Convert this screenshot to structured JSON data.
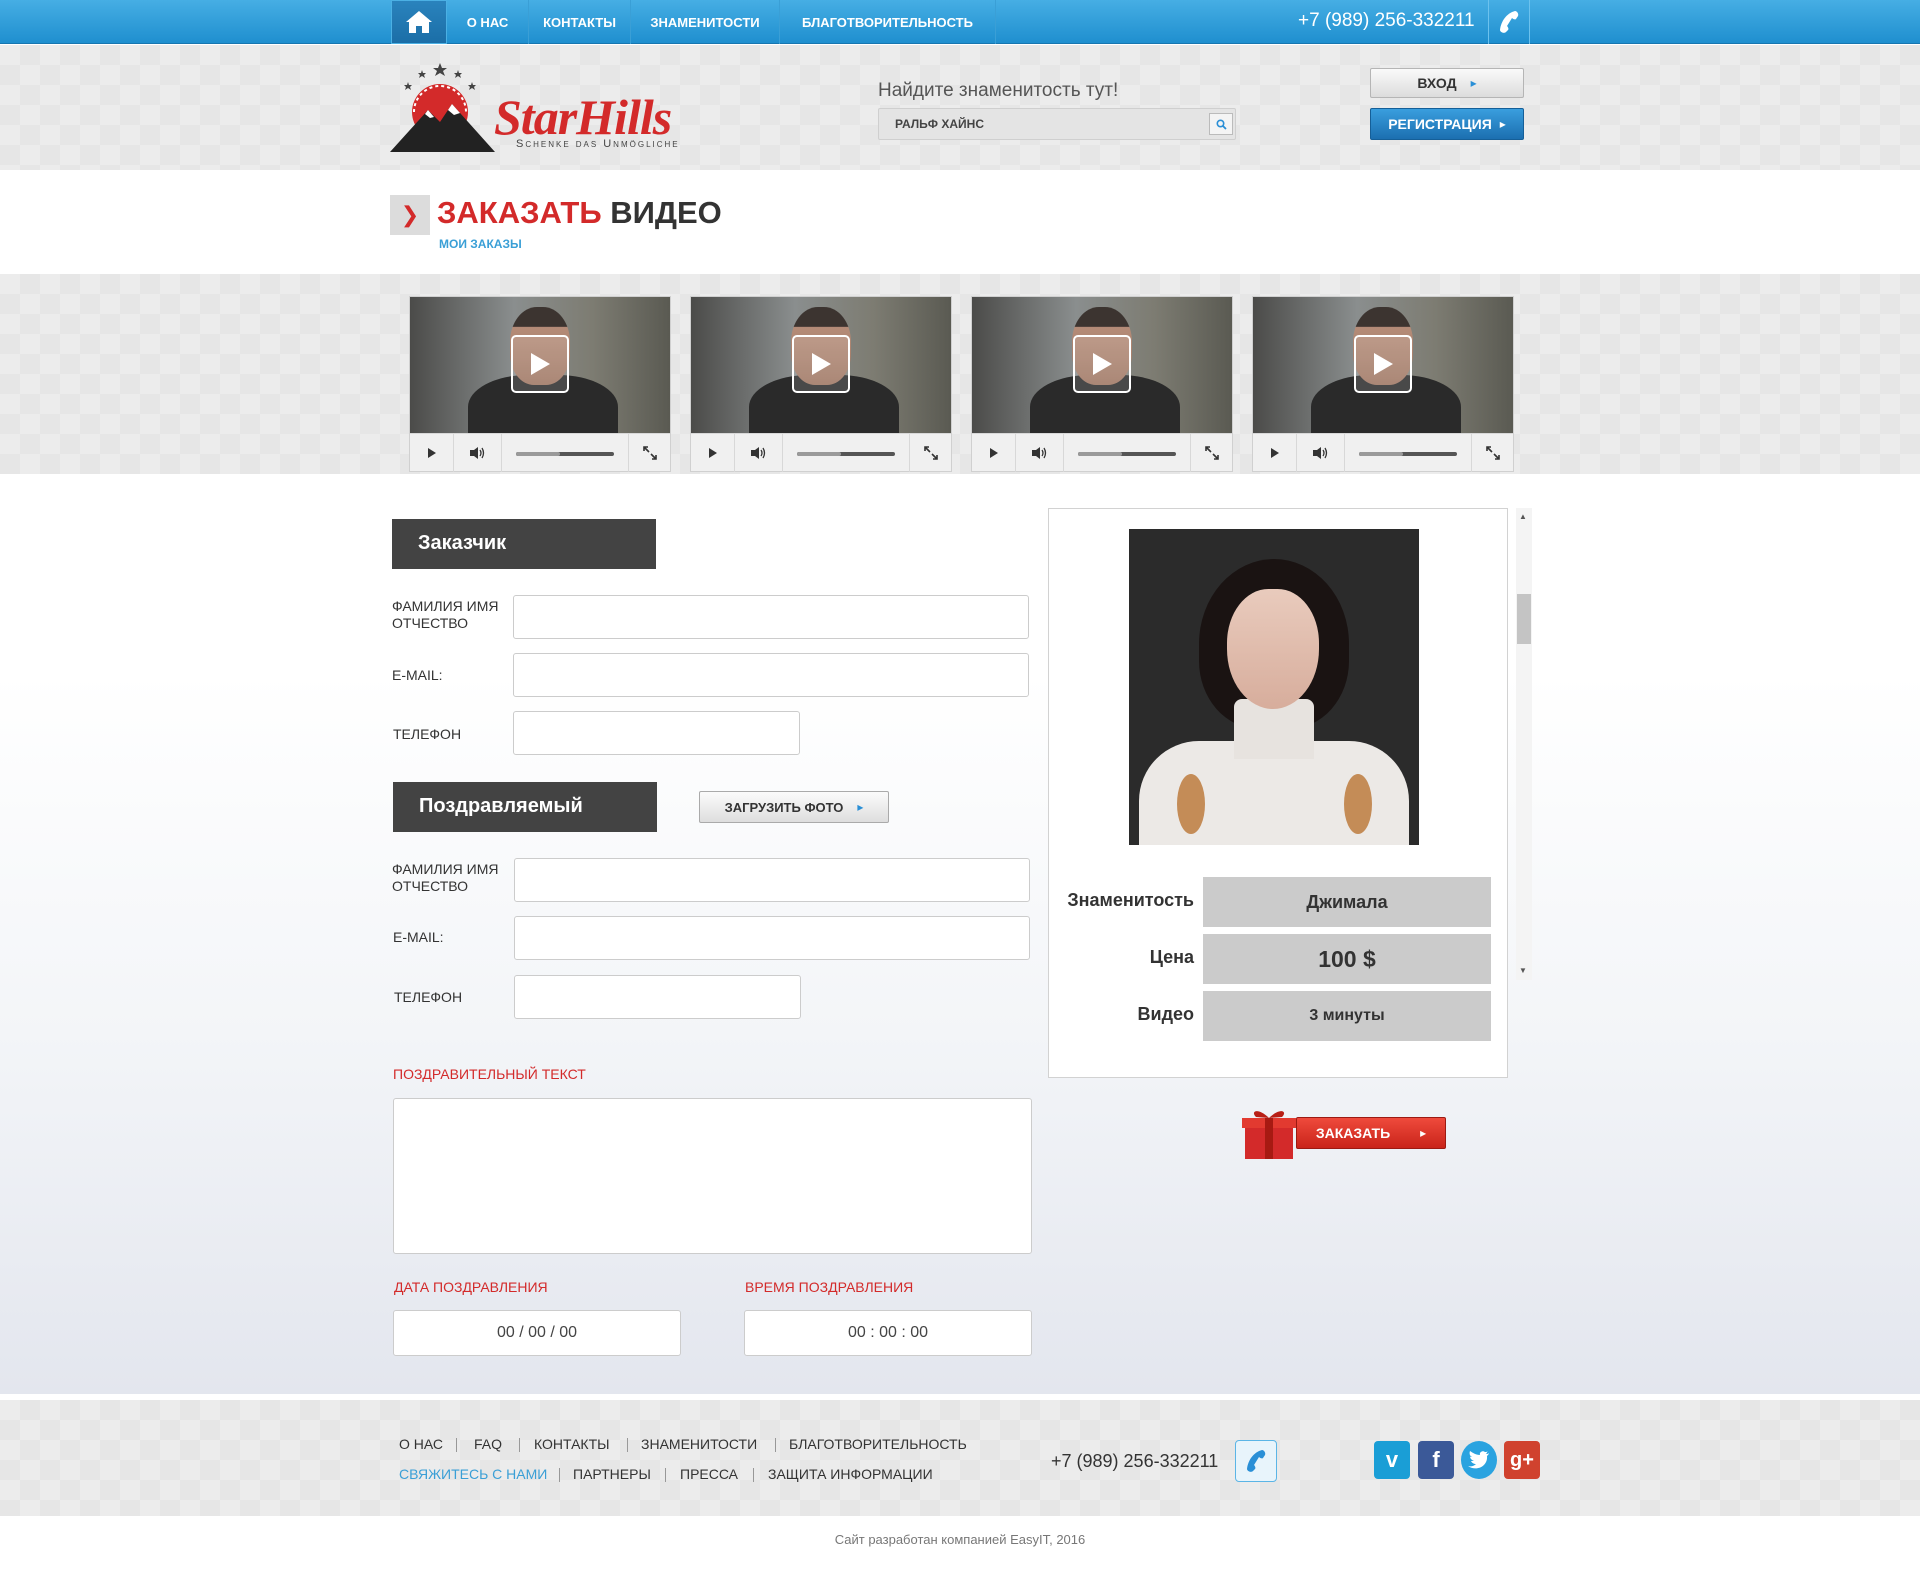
{
  "topnav": {
    "items": [
      "О НАС",
      "КОНТАКТЫ",
      "ЗНАМЕНИТОСТИ",
      "БЛАГОТВОРИТЕЛЬНОСТЬ"
    ],
    "phone": "+7 (989) 256-332211"
  },
  "header": {
    "brand": "StarHills",
    "tagline": "Schenke das Unmögliche",
    "search_label": "Найдите знаменитость тут!",
    "search_value": "РАЛЬФ ХАЙНС",
    "login": "ВХОД",
    "register": "РЕГИСТРАЦИЯ"
  },
  "page": {
    "title_accent": "ЗАКАЗАТЬ",
    "title_rest": "ВИДЕО",
    "my_orders": "МОИ ЗАКАЗЫ"
  },
  "videos": {
    "count": 4,
    "progress": 0.45
  },
  "form": {
    "customer": {
      "heading": "Заказчик",
      "name_label": "ФАМИЛИЯ ИМЯ ОТЧЕСТВО",
      "email_label": "E-MAIL:",
      "phone_label": "ТЕЛЕФОН"
    },
    "recipient": {
      "heading": "Поздравляемый",
      "upload": "ЗАГРУЗИТЬ ФОТО",
      "name_label": "ФАМИЛИЯ ИМЯ ОТЧЕСТВО",
      "email_label": "E-MAIL:",
      "phone_label": "ТЕЛЕФОН"
    },
    "greeting_label": "ПОЗДРАВИТЕЛЬНЫЙ ТЕКСТ",
    "date_label": "ДАТА ПОЗДРАВЛЕНИЯ",
    "date_value": "00 / 00 / 00",
    "time_label": "ВРЕМЯ ПОЗДРАВЛЕНИЯ",
    "time_value": "00 : 00 : 00"
  },
  "card": {
    "celebrity_label": "Знаменитость",
    "celebrity_value": "Джимала",
    "price_label": "Цена",
    "price_value": "100 $",
    "video_label": "Видео",
    "video_value": "3 минуты",
    "order": "ЗАКАЗАТЬ"
  },
  "footer": {
    "row1": [
      "О НАС",
      "FAQ",
      "КОНТАКТЫ",
      "ЗНАМЕНИТОСТИ",
      "БЛАГОТВОРИТЕЛЬНОСТЬ"
    ],
    "row2": [
      "СВЯЖИТЕСЬ С НАМИ",
      "ПАРТНЕРЫ",
      "ПРЕССА",
      "ЗАЩИТА ИНФОРМАЦИИ"
    ],
    "phone": "+7 (989) 256-332211",
    "social": [
      "vimeo-icon",
      "facebook-icon",
      "twitter-icon",
      "google-plus-icon"
    ],
    "copyright": "Сайт разработан компанией EasyIT, 2016"
  },
  "colors": {
    "accent_red": "#d32a2a",
    "accent_blue": "#3a9fd6",
    "dark_header": "#434343"
  }
}
